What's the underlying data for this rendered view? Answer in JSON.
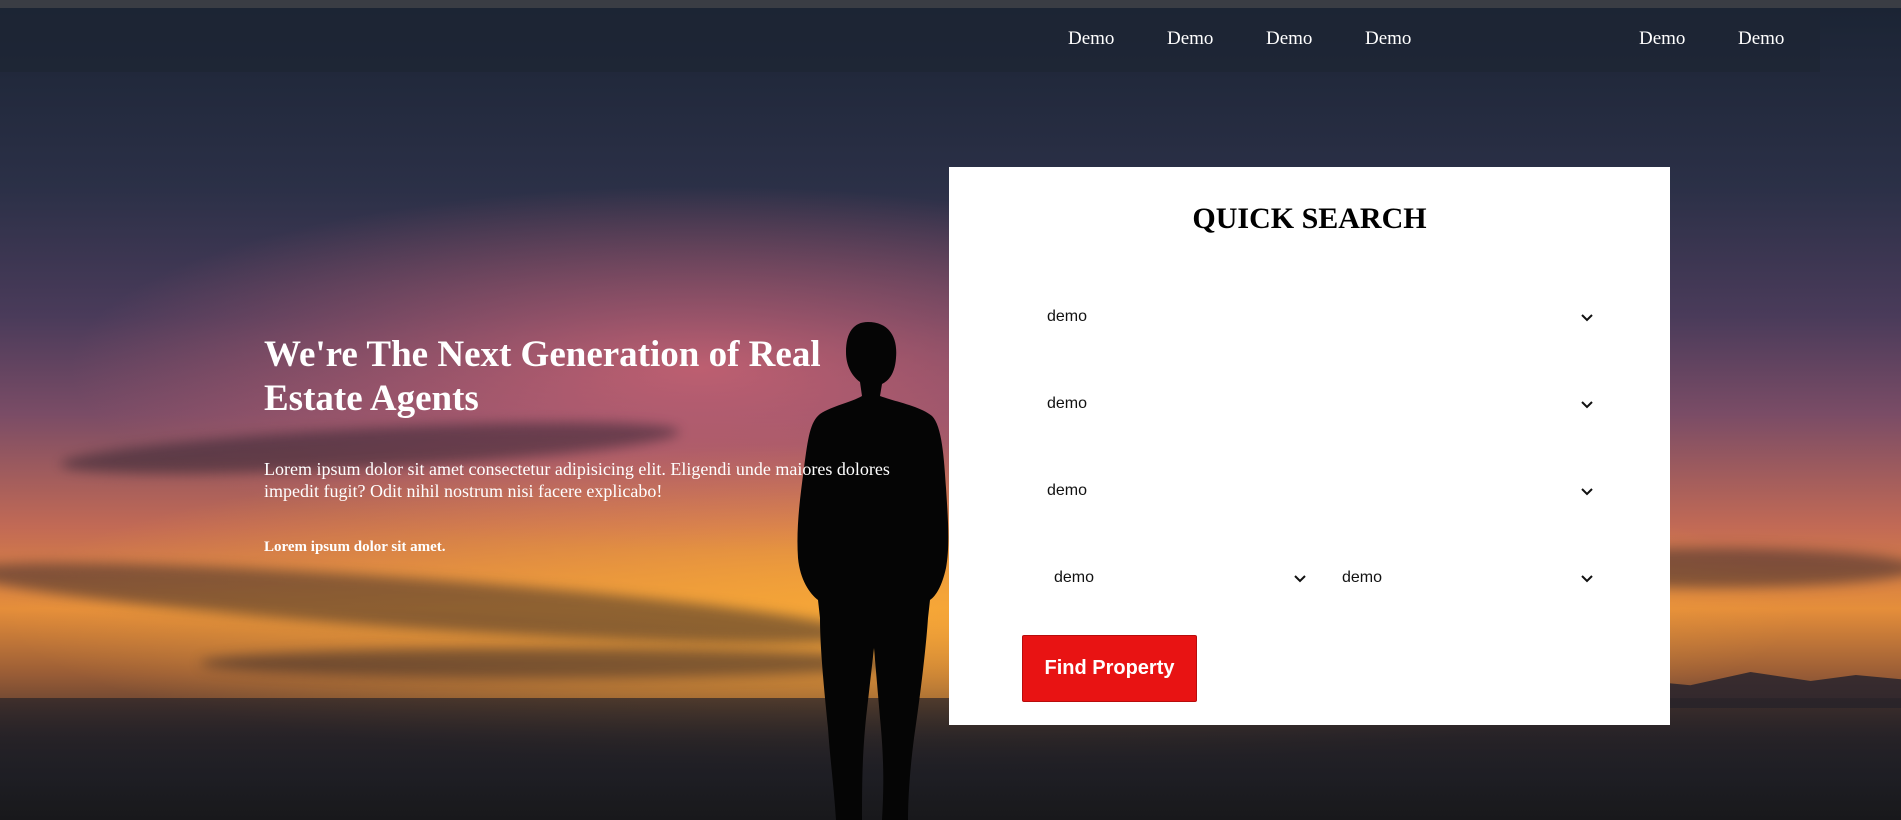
{
  "nav": {
    "items": [
      {
        "label": "Demo"
      },
      {
        "label": "Demo"
      },
      {
        "label": "Demo"
      },
      {
        "label": "Demo"
      },
      {
        "label": "Demo"
      },
      {
        "label": "Demo"
      }
    ]
  },
  "hero": {
    "headline": "We're The Next Generation of Real Estate Agents",
    "lead": "Lorem ipsum dolor sit amet consectetur adipisicing elit. Eligendi unde maiores dolores impedit fugit? Odit nihil nostrum nisi facere explicabo!",
    "note": "Lorem ipsum dolor sit amet."
  },
  "search": {
    "title": "QUICK SEARCH",
    "selects": [
      {
        "value": "demo"
      },
      {
        "value": "demo"
      },
      {
        "value": "demo"
      },
      {
        "value": "demo"
      },
      {
        "value": "demo"
      }
    ],
    "button_label": "Find Property"
  },
  "colors": {
    "accent": "#e81313",
    "panel": "#ffffff",
    "navbar": "#1e2634"
  },
  "icons": {
    "select_arrow": "chevron-down-icon"
  }
}
